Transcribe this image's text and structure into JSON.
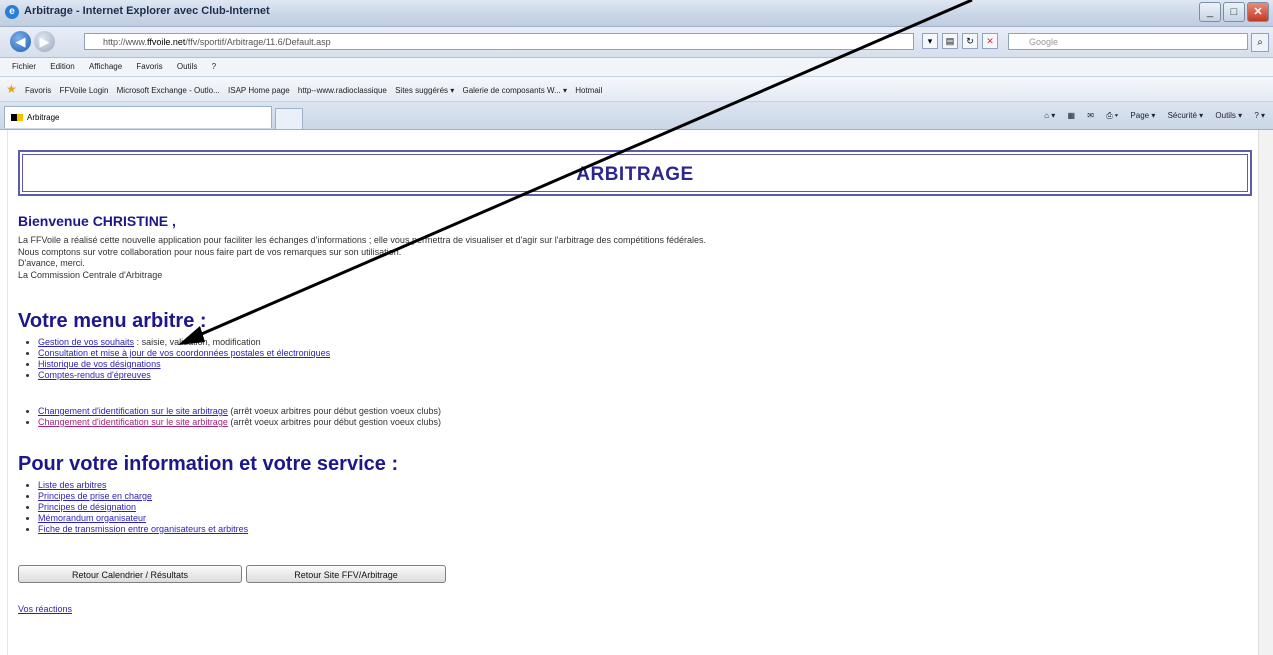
{
  "window": {
    "title": "Arbitrage - Internet Explorer avec Club-Internet",
    "buttons": [
      "_",
      "□",
      "✕"
    ]
  },
  "address_bar": {
    "prefix": "http://www.",
    "domain": "ffvoile.net",
    "path": "/ffv/sportif/Arbitrage/11.6/Default.asp",
    "search_placeholder": "Google"
  },
  "menu_bar": [
    "Fichier",
    "Edition",
    "Affichage",
    "Favoris",
    "Outils",
    "?"
  ],
  "favorites_bar": [
    "Favoris",
    "FFVoile Login",
    "Microsoft Exchange - Outlo...",
    "ISAP Home page",
    "http--www.radioclassique",
    "Sites suggérés ▾",
    "Galerie de composants W... ▾",
    "Hotmail"
  ],
  "tab": {
    "label": "Arbitrage"
  },
  "command_bar": [
    "Page ▾",
    "Sécurité ▾",
    "Outils ▾"
  ],
  "page": {
    "banner_title": "ARBITRAGE",
    "welcome": "Bienvenue CHRISTINE ,",
    "intro_lines": [
      "La FFVoile a réalisé cette nouvelle application pour faciliter les échanges d'informations ; elle vous permettra de visualiser et d'agir sur l'arbitrage des compétitions fédérales.",
      "Nous comptons sur votre collaboration pour nous faire part de vos remarques sur son utilisation.",
      "D'avance, merci.",
      "La Commission Centrale d'Arbitrage"
    ],
    "menu_heading": "Votre menu arbitre :",
    "menu_items": [
      {
        "link": "Gestion de vos souhaits",
        "suffix": " : saisie, validation, modification"
      },
      {
        "link": "Consultation et mise à jour de vos coordonnées postales et électroniques",
        "suffix": ""
      },
      {
        "link": "Historique de vos désignations",
        "suffix": ""
      },
      {
        "link": "Comptes-rendus d'épreuves",
        "suffix": ""
      }
    ],
    "menu_items_2": [
      {
        "link": "Changement d'identification sur le site arbitrage",
        "suffix": " (arrêt voeux arbitres pour début gestion voeux clubs)"
      },
      {
        "link": "Changement d'identification sur le site arbitrage",
        "suffix": " (arrêt voeux arbitres pour début gestion voeux clubs)"
      }
    ],
    "info_heading": "Pour votre information et votre service :",
    "info_items": [
      "Liste des arbitres",
      "Principes de prise en charge",
      "Principes de désignation",
      "Mémorandum organisateur",
      "Fiche de transmission entre organisateurs et arbitres"
    ],
    "button_calendar": "Retour Calendrier / Résultats",
    "button_site": "Retour Site FFV/Arbitrage",
    "reactions_link": "Vos réactions"
  }
}
